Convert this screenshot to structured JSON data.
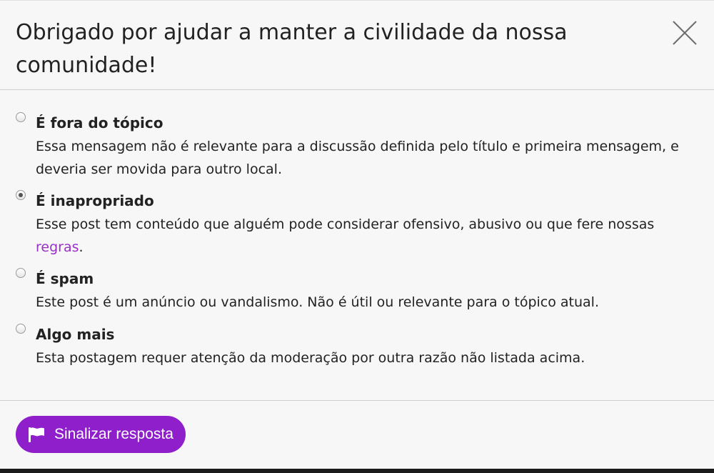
{
  "modal": {
    "title": "Obrigado por ajudar a manter a civilidade da nossa comunidade!",
    "close_icon": "close-icon"
  },
  "options": [
    {
      "title": "É fora do tópico",
      "description": "Essa mensagem não é relevante para a discussão definida pelo título e primeira mensagem, e deveria ser movida para outro local.",
      "checked": false
    },
    {
      "title": "É inapropriado",
      "description_before": "Esse post tem conteúdo que alguém pode considerar ofensivo, abusivo ou que fere nossas ",
      "link_text": "regras",
      "description_after": ".",
      "checked": true
    },
    {
      "title": "É spam",
      "description": "Este post é um anúncio ou vandalismo. Não é útil ou relevante para o tópico atual.",
      "checked": false
    },
    {
      "title": "Algo mais",
      "description": "Esta postagem requer atenção da moderação por outra razão não listada acima.",
      "checked": false
    }
  ],
  "footer": {
    "submit_label": "Sinalizar resposta",
    "submit_icon": "flag-icon"
  },
  "colors": {
    "accent": "#8f1fcb",
    "link": "#9b2fc6",
    "background": "#f7f7f7",
    "text": "#222222"
  }
}
